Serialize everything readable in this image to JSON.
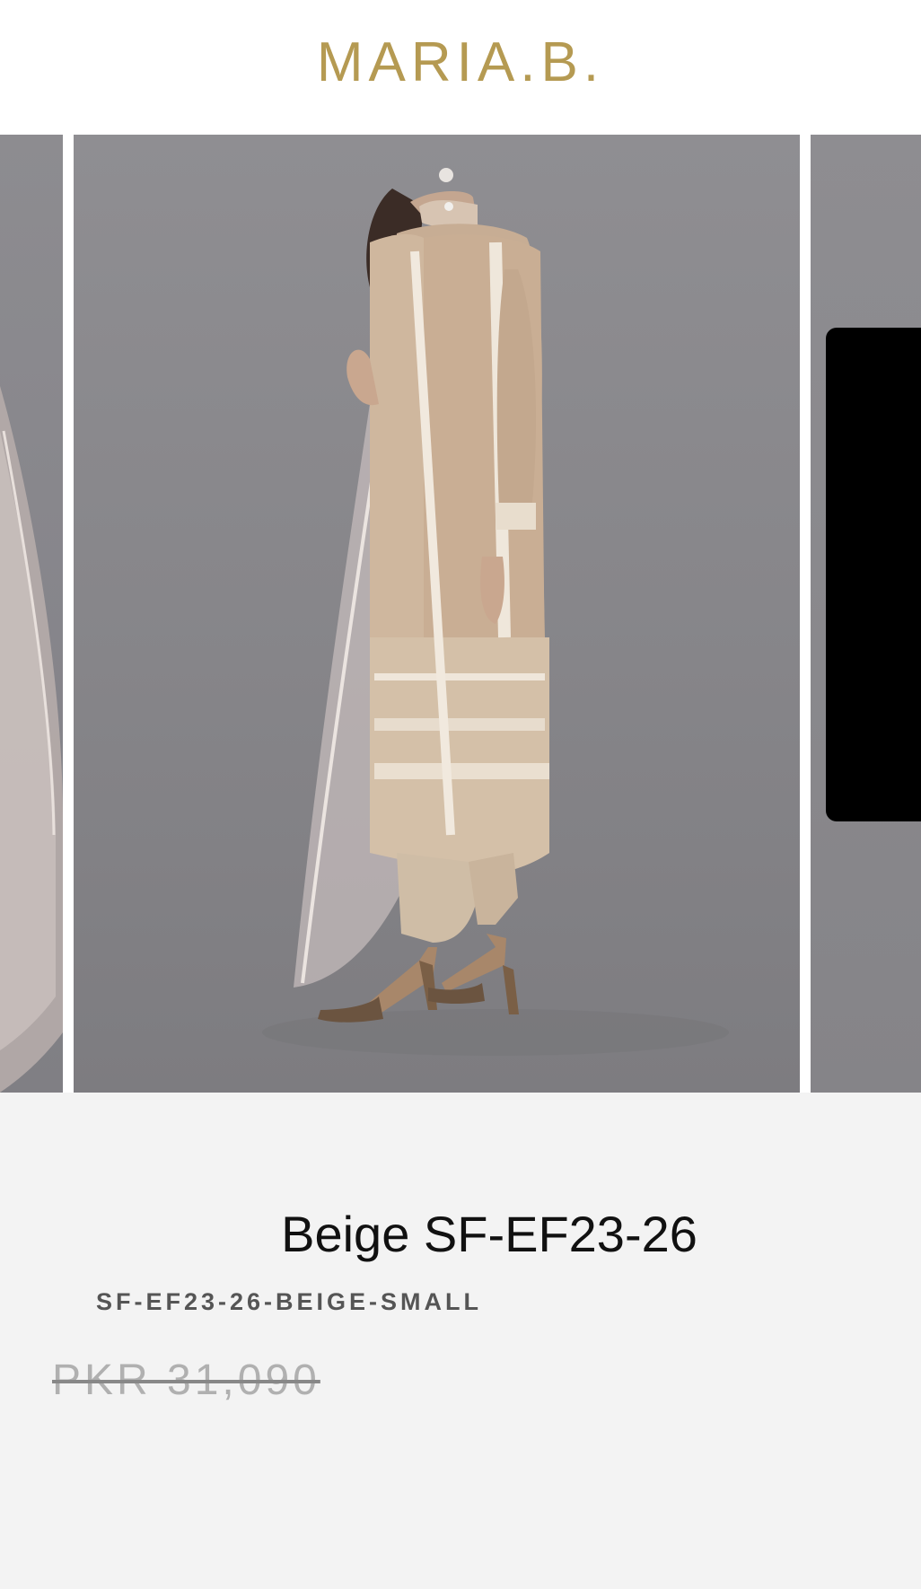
{
  "header": {
    "brand": "MARIA.B."
  },
  "product": {
    "title": "Beige SF-EF23-26",
    "sku": "SF-EF23-26-BEIGE-SMALL",
    "price": "PKR 31,090"
  },
  "colors": {
    "brand_gold": "#b59a52",
    "photo_background": "#8a8a8c",
    "info_background": "#f3f3f3"
  }
}
